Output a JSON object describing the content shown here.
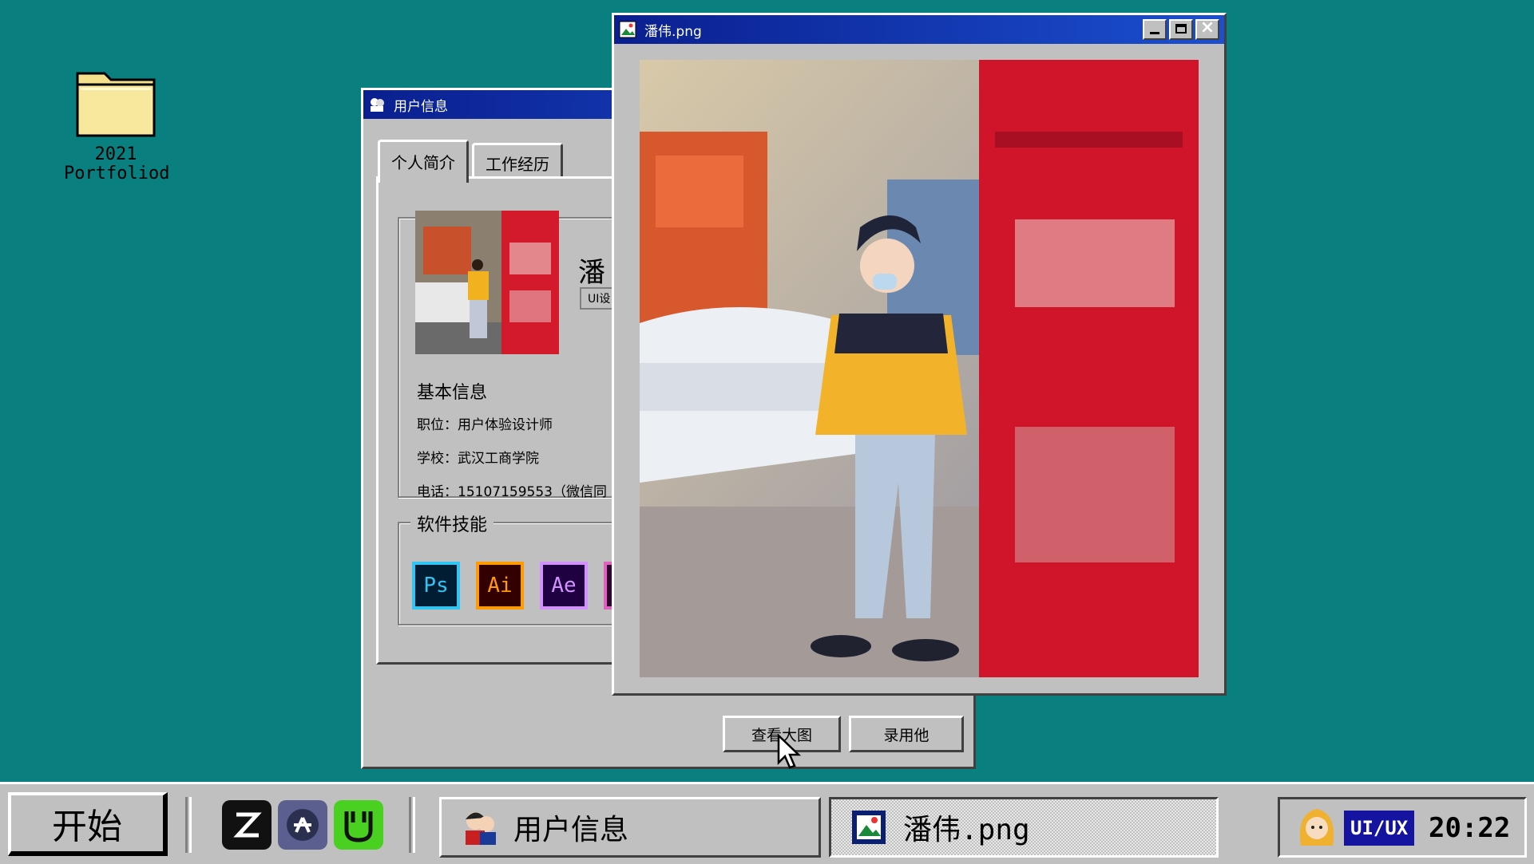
{
  "desktop": {
    "icon_label_line1": "2021",
    "icon_label_line2": "Portfoliod"
  },
  "user_window": {
    "title": "用户信息",
    "tabs": [
      {
        "label": "个人简介"
      },
      {
        "label": "工作经历"
      }
    ],
    "name_partial": "潘",
    "role_tag_partial": "UI设",
    "basic_info": {
      "heading": "基本信息",
      "position": "职位：用户体验设计师",
      "school": "学校：武汉工商学院",
      "phone": "电话：15107159553（微信同"
    },
    "skills": {
      "heading": "软件技能",
      "items": [
        {
          "label": "Ps",
          "color": "#31c5f4",
          "bg": "#001d34"
        },
        {
          "label": "Ai",
          "color": "#ff9a00",
          "bg": "#330000"
        },
        {
          "label": "Ae",
          "color": "#d291ff",
          "bg": "#1f0040"
        }
      ]
    },
    "buttons": {
      "view_large": "查看大图",
      "hire": "录用他"
    }
  },
  "image_window": {
    "title": "潘伟.png"
  },
  "taskbar": {
    "start_label": "开始",
    "tasks": [
      {
        "label": "用户信息"
      },
      {
        "label": "潘伟.png"
      }
    ],
    "tray_badge": "UI/UX",
    "clock": "20:22"
  },
  "colors": {
    "desktop": "#0a7f7f",
    "titlebar": "#0a1f8f",
    "face": "#c0c0c0"
  }
}
